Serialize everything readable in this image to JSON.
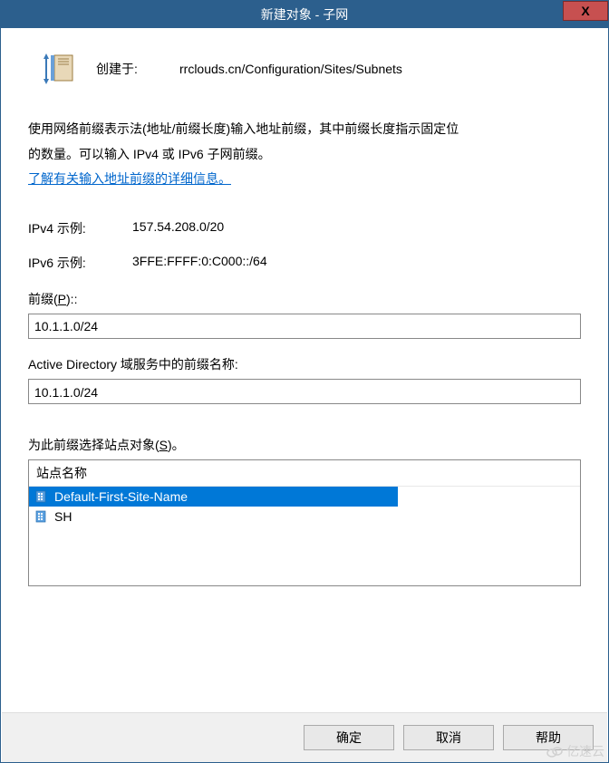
{
  "titlebar": {
    "title": "新建对象 - 子网",
    "close": "X"
  },
  "header": {
    "created_label": "创建于:",
    "created_path": "rrclouds.cn/Configuration/Sites/Subnets"
  },
  "description": {
    "line1": "使用网络前缀表示法(地址/前缀长度)输入地址前缀，其中前缀长度指示固定位",
    "line2": "的数量。可以输入 IPv4 或 IPv6 子网前缀。",
    "link": "了解有关输入地址前缀的详细信息。"
  },
  "examples": {
    "ipv4_label": "IPv4 示例:",
    "ipv4_value": "157.54.208.0/20",
    "ipv6_label": "IPv6 示例:",
    "ipv6_value": "3FFE:FFFF:0:C000::/64"
  },
  "prefix": {
    "label_pre": "前缀(",
    "label_key": "P",
    "label_post": ")::",
    "value": "10.1.1.0/24"
  },
  "ad_prefix": {
    "label": "Active Directory 域服务中的前缀名称:",
    "value": "10.1.1.0/24"
  },
  "sites": {
    "label_pre": "为此前缀选择站点对象(",
    "label_key": "S",
    "label_post": ")。",
    "header": "站点名称",
    "items": [
      {
        "name": "Default-First-Site-Name",
        "selected": true
      },
      {
        "name": "SH",
        "selected": false
      }
    ]
  },
  "buttons": {
    "ok": "确定",
    "cancel": "取消",
    "help": "帮助"
  },
  "watermark": "亿速云"
}
